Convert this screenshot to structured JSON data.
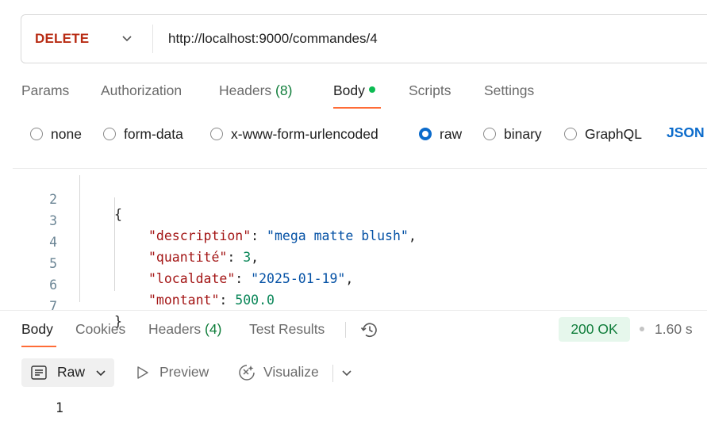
{
  "request": {
    "method": "DELETE",
    "url": "http://localhost:9000/commandes/4"
  },
  "request_tabs": {
    "params": "Params",
    "authorization": "Authorization",
    "headers_label": "Headers",
    "headers_count": "(8)",
    "body": "Body",
    "scripts": "Scripts",
    "settings": "Settings"
  },
  "body_types": {
    "none": "none",
    "form_data": "form-data",
    "urlencoded": "x-www-form-urlencoded",
    "raw": "raw",
    "binary": "binary",
    "graphql": "GraphQL",
    "format": "JSON",
    "selected": "raw"
  },
  "editor": {
    "lines": [
      {
        "n": "2",
        "text": "{"
      },
      {
        "n": "3",
        "key": "\"description\"",
        "value": "\"mega matte blush\"",
        "suffix": ","
      },
      {
        "n": "4",
        "key": "\"quantité\"",
        "value": "3",
        "suffix": ","
      },
      {
        "n": "5",
        "key": "\"localdate\"",
        "value": "\"2025-01-19\"",
        "suffix": ","
      },
      {
        "n": "6",
        "key": "\"montant\"",
        "value": "500.0",
        "suffix": ""
      },
      {
        "n": "7",
        "text": "}"
      }
    ]
  },
  "response": {
    "tabs": {
      "body": "Body",
      "cookies": "Cookies",
      "headers_label": "Headers",
      "headers_count": "(4)",
      "test_results": "Test Results"
    },
    "status": "200 OK",
    "time": "1.60 s",
    "view": {
      "raw": "Raw",
      "preview": "Preview",
      "visualize": "Visualize"
    },
    "body_lines": [
      {
        "n": "1"
      }
    ]
  },
  "colors": {
    "method": "#b82c14",
    "accent": "#ff6c37",
    "status_ok": "#0f7d3a",
    "link": "#0b6bcb"
  }
}
